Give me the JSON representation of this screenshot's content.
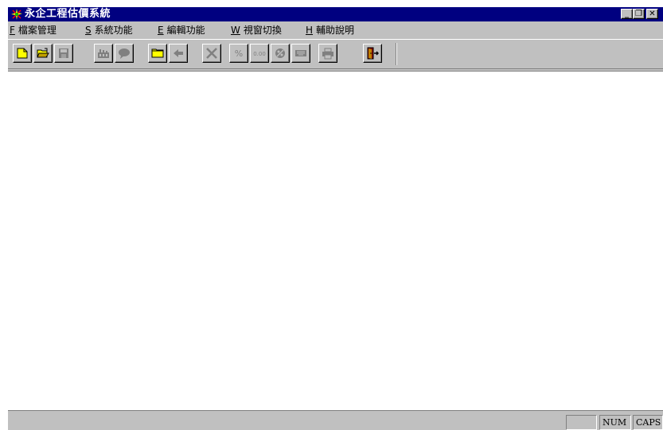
{
  "window": {
    "title": "永企工程估價系統",
    "controls": {
      "minimize": "_",
      "maximize": "❐",
      "close": "✕"
    }
  },
  "menu": [
    {
      "accel": "F",
      "label": "檔案管理"
    },
    {
      "accel": "S",
      "label": "系統功能"
    },
    {
      "accel": "E",
      "label": "編輯功能"
    },
    {
      "accel": "W",
      "label": "視窗切換"
    },
    {
      "accel": "H",
      "label": "輔助說明"
    }
  ],
  "toolbar": {
    "buttons": [
      {
        "name": "new-file-icon",
        "enabled": true
      },
      {
        "name": "open-folder-icon",
        "enabled": true
      },
      {
        "name": "save-disk-icon",
        "enabled": false
      },
      {
        "name": "factory-icon",
        "enabled": false
      },
      {
        "name": "speech-bubble-icon",
        "enabled": false
      },
      {
        "name": "folder-icon",
        "enabled": true
      },
      {
        "name": "back-arrow-icon",
        "enabled": false
      },
      {
        "name": "delete-x-icon",
        "enabled": false
      },
      {
        "name": "percent-icon",
        "label": "%",
        "enabled": false
      },
      {
        "name": "decimal-icon",
        "label": "0.00",
        "enabled": false
      },
      {
        "name": "calculator-icon",
        "enabled": false
      },
      {
        "name": "keyboard-icon",
        "enabled": false
      },
      {
        "name": "printer-icon",
        "enabled": false
      },
      {
        "name": "exit-door-icon",
        "enabled": true
      }
    ]
  },
  "statusbar": {
    "message": "",
    "extra": "",
    "num": "NUM",
    "caps": "CAPS"
  }
}
